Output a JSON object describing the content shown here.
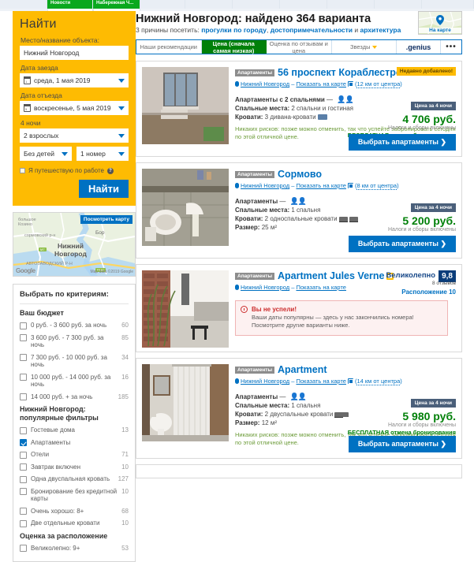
{
  "browser_strip": {
    "tabs": [
      {
        "label": "Новости"
      },
      {
        "label": "Набережная Ч..."
      }
    ]
  },
  "search_box": {
    "title": "Найти",
    "destination_label": "Место/название объекта:",
    "destination_value": "Нижний Новгород",
    "checkin_label": "Дата заезда",
    "checkin_value": "среда, 1 мая 2019",
    "checkout_label": "Дата отъезда",
    "checkout_value": "воскресенье, 5 мая 2019",
    "nights_label": "4 ночи",
    "adults_value": "2 взрослых",
    "children_value": "Без детей",
    "rooms_value": "1 номер",
    "business_label": "Я путешествую по работе",
    "help_icon": "?",
    "submit_label": "Найти"
  },
  "map_widget": {
    "button_label": "Посмотреть карту",
    "city_line1": "Нижний",
    "city_line2": "Новгород",
    "districts": [
      "большое\nКозино",
      "сормовский р-н",
      "Бор",
      "АВТОЗАВОДСКИЙ Р-Н"
    ],
    "brand": "Google",
    "attribution": "Map data ©2019 Google",
    "highway_labels": [
      "Р152",
      "М7"
    ]
  },
  "filters": {
    "heading": "Выбрать по критериям:",
    "groups": [
      {
        "title": "Ваш бюджет",
        "items": [
          {
            "label": "0 руб. - 3 600 руб. за ночь",
            "count": "60",
            "checked": false
          },
          {
            "label": "3 600 руб. - 7 300 руб. за ночь",
            "count": "85",
            "checked": false
          },
          {
            "label": "7 300 руб. - 10 000 руб. за ночь",
            "count": "34",
            "checked": false
          },
          {
            "label": "10 000 руб. - 14 000 руб. за ночь",
            "count": "16",
            "checked": false
          },
          {
            "label": "14 000 руб. + за ночь",
            "count": "185",
            "checked": false
          }
        ]
      },
      {
        "title": "Нижний Новгород: популярные фильтры",
        "items": [
          {
            "label": "Гостевые дома",
            "count": "13",
            "checked": false
          },
          {
            "label": "Апартаменты",
            "count": "",
            "checked": true
          },
          {
            "label": "Отели",
            "count": "71",
            "checked": false
          },
          {
            "label": "Завтрак включен",
            "count": "10",
            "checked": false
          },
          {
            "label": "Одна двуспальная кровать",
            "count": "127",
            "checked": false
          },
          {
            "label": "Бронирование без кредитной карты",
            "count": "10",
            "checked": false
          },
          {
            "label": "Очень хорошо: 8+",
            "count": "68",
            "checked": false
          },
          {
            "label": "Две отдельные кровати",
            "count": "10",
            "checked": false
          }
        ]
      },
      {
        "title": "Оценка за расположение",
        "items": [
          {
            "label": "Великолепно: 9+",
            "count": "53",
            "checked": false
          }
        ]
      }
    ]
  },
  "results_header": {
    "title": "Нижний Новгород: найдено 364 варианта",
    "subtitle_prefix": "3 причины посетить: ",
    "reason1": "прогулки по городу",
    "subtitle_sep1": ", ",
    "reason2": "достопримечательности",
    "subtitle_sep2": " и ",
    "reason3": "архитектура",
    "map_button_label": "На карте"
  },
  "sort_tabs": [
    {
      "label": "Наши рекомендации",
      "active": false
    },
    {
      "label": "Цена (сначала самая низкая)",
      "active": true
    },
    {
      "label": "Оценка по отзывам и цена",
      "active": false
    },
    {
      "label": "Звезды",
      "active": false,
      "has_caret": true
    },
    {
      "label": ".genius",
      "active": false,
      "kind": "genius"
    },
    {
      "label": "•••",
      "active": false,
      "kind": "more"
    }
  ],
  "cards": [
    {
      "type_badge": "Апартаменты",
      "name": "56 проспект Кораблестроителей",
      "newly_added": "Недавно добавлено!",
      "city": "Нижний Новгород",
      "map_link": "Показать на карте",
      "distance": "12 км от центра",
      "room_title": "Апартаменты с 2 спальнями",
      "beds_label": "Спальные места:",
      "beds_value": "2 спальни и гостиная",
      "beds2_label": "Кровати:",
      "beds2_value": "3 дивана-кровати",
      "size_label": "",
      "size_value": "",
      "risk_note": "Никаких рисков: позже можно отменить, так что успейте забронировать сегодня по этой отличной цене.",
      "price_tag": "Цена за 4 ночи",
      "price": "4 706 руб.",
      "price_tax": "Налоги и сборы включены",
      "free_cancel": "БЕСПЛАТНАЯ отмена бронирования",
      "select_label": "Выбрать апартаменты"
    },
    {
      "type_badge": "Апартаменты",
      "name": "Сормово",
      "newly_added": "",
      "city": "Нижний Новгород",
      "map_link": "Показать на карте",
      "distance": "8 км от центра",
      "room_title": "Апартаменты",
      "beds_label": "Спальные места:",
      "beds_value": "1 спальня",
      "beds2_label": "Кровати:",
      "beds2_value": "2 односпальные кровати",
      "size_label": "Размер:",
      "size_value": "25 м²",
      "risk_note": "",
      "price_tag": "Цена за 4 ночи",
      "price": "5 200 руб.",
      "price_tax": "Налоги и сборы включены",
      "free_cancel": "",
      "select_label": "Выбрать апартаменты"
    },
    {
      "type_badge": "Апартаменты",
      "name": "Apartment Jules Verne",
      "newly_added": "",
      "city": "Нижний Новгород",
      "map_link": "Показать на карте",
      "distance": "",
      "score_word": "Великолепно",
      "score_count": "8 отзывов",
      "score_value": "9,8",
      "score_location": "Расположение 10",
      "soldout_title": "Вы не успели!",
      "soldout_body": "Ваши даты популярны — здесь у нас закончились номера! Посмотрите другие варианты ниже."
    },
    {
      "type_badge": "Апартаменты",
      "name": "Apartment",
      "newly_added": "",
      "city": "Нижний Новгород",
      "map_link": "Показать на карте",
      "distance": "14 км от центра",
      "room_title": "Апартаменты",
      "beds_label": "Спальные места:",
      "beds_value": "1 спальня",
      "beds2_label": "Кровати:",
      "beds2_value": "2 двуспальные кровати",
      "size_label": "Размер:",
      "size_value": "12 м²",
      "risk_note": "Никаких рисков: позже можно отменить, так что успейте забронировать сегодня по этой отличной цене.",
      "price_tag": "Цена за 4 ночи",
      "price": "5 980 руб.",
      "price_tax": "Налоги и сборы включены",
      "free_cancel": "БЕСПЛАТНАЯ отмена бронирования",
      "select_label": "Выбрать апартаменты"
    }
  ],
  "colors": {
    "brand_yellow": "#febb02",
    "brand_blue": "#0071c2",
    "active_green": "#008009",
    "price_green": "#008009",
    "alert_red": "#cc2d2d"
  }
}
